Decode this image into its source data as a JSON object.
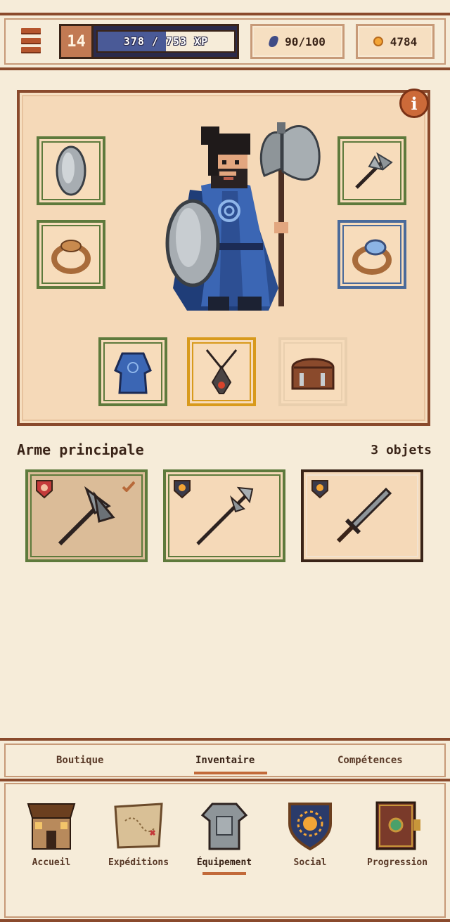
{
  "header": {
    "level": "14",
    "xp_text": "378 / 753 XP",
    "xp_progress": 0.5,
    "energy": "90/100",
    "gold": "4784"
  },
  "equipment": {
    "slots": [
      {
        "name": "shield",
        "frame": "green"
      },
      {
        "name": "ring-gold",
        "frame": "green"
      },
      {
        "name": "axe",
        "frame": "green"
      },
      {
        "name": "ring-sapphire",
        "frame": "blue"
      },
      {
        "name": "robe",
        "frame": "green"
      },
      {
        "name": "amulet",
        "frame": "gold"
      },
      {
        "name": "backpack",
        "frame": "empty"
      }
    ]
  },
  "weapons": {
    "title": "Arme principale",
    "count": "3 objets",
    "items": [
      {
        "name": "double-axe",
        "badge": "red",
        "equipped": true
      },
      {
        "name": "halberd",
        "badge": "dark"
      },
      {
        "name": "sword",
        "badge": "dark"
      }
    ]
  },
  "tabs": [
    "Boutique",
    "Inventaire",
    "Compétences"
  ],
  "active_tab": "Inventaire",
  "nav": {
    "items": [
      {
        "label": "Accueil",
        "icon": "house-icon"
      },
      {
        "label": "Expéditions",
        "icon": "map-icon"
      },
      {
        "label": "Équipement",
        "icon": "armor-icon"
      },
      {
        "label": "Social",
        "icon": "sun-shield-icon"
      },
      {
        "label": "Progression",
        "icon": "book-icon"
      }
    ],
    "active": "Équipement"
  },
  "colors": {
    "accent": "#8a4a2c",
    "frame_green": "#5e7a3c",
    "frame_blue": "#4a6a9a",
    "frame_gold": "#d89a1c",
    "xp_fill": "#4a5a97"
  }
}
